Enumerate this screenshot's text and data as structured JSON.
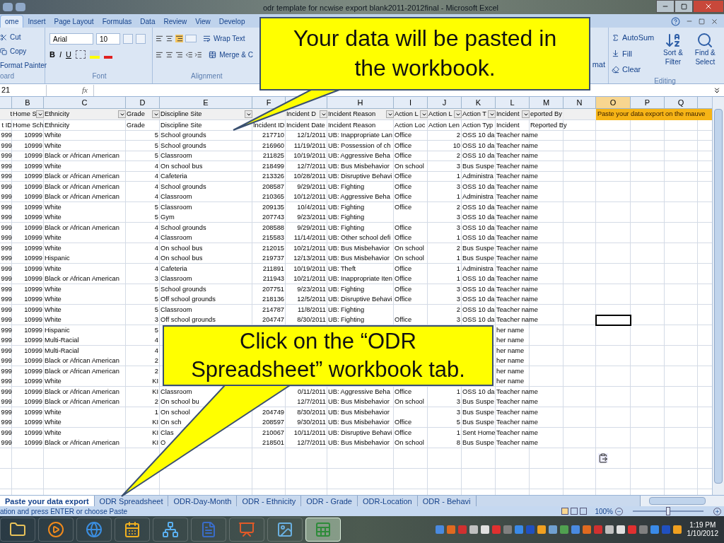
{
  "window": {
    "title": "odr template for ncwise export blank2011-2012final - Microsoft Excel"
  },
  "ribbon": {
    "tabs": [
      {
        "label": "ome",
        "selected": true
      },
      {
        "label": "Insert",
        "selected": false
      },
      {
        "label": "Page Layout",
        "selected": false
      },
      {
        "label": "Formulas",
        "selected": false
      },
      {
        "label": "Data",
        "selected": false
      },
      {
        "label": "Review",
        "selected": false
      },
      {
        "label": "View",
        "selected": false
      },
      {
        "label": "Develop",
        "selected": false
      }
    ],
    "clipboard": {
      "cut": "Cut",
      "copy": "Copy",
      "format_painter": "Format Painter",
      "label": "oard"
    },
    "font": {
      "name": "Arial",
      "size": "10",
      "bold": "B",
      "italic": "I",
      "underline": "U",
      "label": "Font"
    },
    "alignment": {
      "wrap": "Wrap Text",
      "merge": "Merge & C",
      "label": "Alignment"
    },
    "cells_fragment": "mat",
    "editing": {
      "autosum": "AutoSum",
      "fill": "Fill",
      "clear": "Clear",
      "sort": "Sort & Filter",
      "find": "Find & Select",
      "label": "Editing"
    }
  },
  "formula_bar": {
    "name_box": "21",
    "fx": "fx"
  },
  "columns": [
    {
      "letter": "B",
      "selected": false
    },
    {
      "letter": "C",
      "selected": false
    },
    {
      "letter": "D",
      "selected": false
    },
    {
      "letter": "E",
      "selected": false
    },
    {
      "letter": "F",
      "selected": false
    },
    {
      "selected": false
    },
    {
      "letter": "H",
      "selected": false
    },
    {
      "letter": "I",
      "selected": false
    },
    {
      "letter": "J",
      "selected": false
    },
    {
      "letter": "K",
      "selected": false
    },
    {
      "letter": "L",
      "selected": false
    },
    {
      "letter": "M",
      "selected": false
    },
    {
      "letter": "N",
      "selected": false
    },
    {
      "letter": "O",
      "selected": true
    },
    {
      "letter": "P",
      "selected": false
    },
    {
      "letter": "Q",
      "selected": false
    }
  ],
  "filter_row": {
    "A": "t",
    "B": "Home S",
    "C": "Ethnicity",
    "D": "Grade",
    "E": "Discipline Site",
    "G": "Incident D",
    "H": "Incident Reason",
    "I": "Action L",
    "J": "Action L",
    "K": "Action T",
    "L": "Incident",
    "M": "eported By"
  },
  "banner": "Paste your data export on the mauve",
  "field_row": {
    "A": "t ID",
    "B": "Home Sch",
    "C": "Ethnicity",
    "D": "Grade",
    "E": "Discipline Site",
    "F": "Incident ID",
    "G": "Incident Date",
    "H": "Incident Reason",
    "I": "Action Loc",
    "J": "Action Len",
    "K": "Action Typ",
    "L": "Incident",
    "M": "Reported By"
  },
  "rows": [
    {
      "active_cell": false,
      "cells": {
        "A": "999",
        "B": "10999",
        "C": "White",
        "D": "5",
        "E": "School grounds",
        "F": "217710",
        "G": "12/1/2011",
        "H": "UB: Inappropriate Lan",
        "I": "Office",
        "J": "2",
        "K": "OSS 10 da",
        "L": "Teacher name"
      }
    },
    {
      "active_cell": false,
      "cells": {
        "A": "999",
        "B": "10999",
        "C": "White",
        "D": "5",
        "E": "School grounds",
        "F": "216960",
        "G": "11/19/2011",
        "H": "UB: Possession of ch",
        "I": "Office",
        "J": "10",
        "K": "OSS 10 da",
        "L": "Teacher name"
      }
    },
    {
      "active_cell": false,
      "cells": {
        "A": "999",
        "B": "10999",
        "C": "Black or African American",
        "D": "5",
        "E": "Classroom",
        "F": "211825",
        "G": "10/19/2011",
        "H": "UB: Aggressive Beha",
        "I": "Office",
        "J": "2",
        "K": "OSS 10 da",
        "L": "Teacher name"
      }
    },
    {
      "active_cell": false,
      "cells": {
        "A": "999",
        "B": "10999",
        "C": "White",
        "D": "4",
        "E": "On school bus",
        "F": "218499",
        "G": "12/7/2011",
        "H": "UB: Bus Misbehavior",
        "I": "On school",
        "J": "3",
        "K": "Bus Suspe",
        "L": "Teacher name"
      }
    },
    {
      "active_cell": false,
      "cells": {
        "A": "999",
        "B": "10999",
        "C": "Black or African American",
        "D": "4",
        "E": "Cafeteria",
        "F": "213326",
        "G": "10/28/2011",
        "H": "UB: Disruptive Behavi",
        "I": "Office",
        "J": "1",
        "K": "Administra",
        "L": "Teacher name"
      }
    },
    {
      "active_cell": false,
      "cells": {
        "A": "999",
        "B": "10999",
        "C": "Black or African American",
        "D": "4",
        "E": "School grounds",
        "F": "208587",
        "G": "9/29/2011",
        "H": "UB: Fighting",
        "I": "Office",
        "J": "3",
        "K": "OSS 10 da",
        "L": "Teacher name"
      }
    },
    {
      "active_cell": false,
      "cells": {
        "A": "999",
        "B": "10999",
        "C": "Black or African American",
        "D": "4",
        "E": "Classroom",
        "F": "210365",
        "G": "10/12/2011",
        "H": "UB: Aggressive Beha",
        "I": "Office",
        "J": "1",
        "K": "Administra",
        "L": "Teacher name"
      }
    },
    {
      "active_cell": false,
      "cells": {
        "A": "999",
        "B": "10999",
        "C": "White",
        "D": "5",
        "E": "Classroom",
        "F": "209135",
        "G": "10/4/2011",
        "H": "UB: Fighting",
        "I": "Office",
        "J": "2",
        "K": "OSS 10 da",
        "L": "Teacher name"
      }
    },
    {
      "active_cell": false,
      "cells": {
        "A": "999",
        "B": "10999",
        "C": "White",
        "D": "5",
        "E": "Gym",
        "F": "207743",
        "G": "9/23/2011",
        "H": "UB: Fighting",
        "J": "3",
        "K": "OSS 10 da",
        "L": "Teacher name"
      }
    },
    {
      "active_cell": false,
      "cells": {
        "A": "999",
        "B": "10999",
        "C": "Black or African American",
        "D": "4",
        "E": "School grounds",
        "F": "208588",
        "G": "9/29/2011",
        "H": "UB: Fighting",
        "I": "Office",
        "J": "3",
        "K": "OSS 10 da",
        "L": "Teacher name"
      }
    },
    {
      "active_cell": false,
      "cells": {
        "A": "999",
        "B": "10999",
        "C": "White",
        "D": "4",
        "E": "Classroom",
        "F": "215583",
        "G": "11/14/2011",
        "H": "UB: Other school defi",
        "I": "Office",
        "J": "1",
        "K": "OSS 10 da",
        "L": "Teacher name"
      }
    },
    {
      "active_cell": false,
      "cells": {
        "A": "999",
        "B": "10999",
        "C": "White",
        "D": "4",
        "E": "On school bus",
        "F": "212015",
        "G": "10/21/2011",
        "H": "UB: Bus Misbehavior",
        "I": "On school",
        "J": "2",
        "K": "Bus Suspe",
        "L": "Teacher name"
      }
    },
    {
      "active_cell": false,
      "cells": {
        "A": "999",
        "B": "10999",
        "C": "Hispanic",
        "D": "4",
        "E": "On school bus",
        "F": "219737",
        "G": "12/13/2011",
        "H": "UB: Bus Misbehavior",
        "I": "On school",
        "J": "1",
        "K": "Bus Suspe",
        "L": "Teacher name"
      }
    },
    {
      "active_cell": false,
      "cells": {
        "A": "999",
        "B": "10999",
        "C": "White",
        "D": "4",
        "E": "Cafeteria",
        "F": "211891",
        "G": "10/19/2011",
        "H": "UB: Theft",
        "I": "Office",
        "J": "1",
        "K": "Administra",
        "L": "Teacher name"
      }
    },
    {
      "active_cell": false,
      "cells": {
        "A": "999",
        "B": "10999",
        "C": "Black or African American",
        "D": "3",
        "E": "Classroom",
        "F": "211943",
        "G": "10/21/2011",
        "H": "UB: Inappropriate Iten",
        "I": "Office",
        "J": "1",
        "K": "OSS 10 da",
        "L": "Teacher name"
      }
    },
    {
      "active_cell": false,
      "cells": {
        "A": "999",
        "B": "10999",
        "C": "White",
        "D": "5",
        "E": "School grounds",
        "F": "207751",
        "G": "9/23/2011",
        "H": "UB: Fighting",
        "I": "Office",
        "J": "3",
        "K": "OSS 10 da",
        "L": "Teacher name"
      }
    },
    {
      "active_cell": false,
      "cells": {
        "A": "999",
        "B": "10999",
        "C": "White",
        "D": "5",
        "E": "Off school grounds",
        "F": "218136",
        "G": "12/5/2011",
        "H": "UB: Disruptive Behavi",
        "I": "Office",
        "J": "3",
        "K": "OSS 10 da",
        "L": "Teacher name"
      }
    },
    {
      "active_cell": false,
      "cells": {
        "A": "999",
        "B": "10999",
        "C": "White",
        "D": "5",
        "E": "Classroom",
        "F": "214787",
        "G": "11/8/2011",
        "H": "UB: Fighting",
        "J": "2",
        "K": "OSS 10 da",
        "L": "Teacher name"
      }
    },
    {
      "active_cell": true,
      "cells": {
        "A": "999",
        "B": "10999",
        "C": "White",
        "D": "3",
        "E": "Off school grounds",
        "F": "204747",
        "G": "8/30/2011",
        "H": "UB: Fighting",
        "I": "Office",
        "J": "3",
        "K": "OSS 10 da",
        "L": "Teacher name"
      }
    },
    {
      "active_cell": false,
      "cells": {
        "A": "999",
        "B": "10999",
        "C": "Hispanic",
        "D": "5",
        "L": "her name"
      }
    },
    {
      "active_cell": false,
      "cells": {
        "A": "999",
        "B": "10999",
        "C": "Multi-Racial",
        "D": "4",
        "L": "her name"
      }
    },
    {
      "active_cell": false,
      "cells": {
        "A": "999",
        "B": "10999",
        "C": "Multi-Racial",
        "D": "4",
        "L": "her name"
      }
    },
    {
      "active_cell": false,
      "cells": {
        "A": "999",
        "B": "10999",
        "C": "Black or African American",
        "D": "2",
        "L": "her name"
      }
    },
    {
      "active_cell": false,
      "cells": {
        "A": "999",
        "B": "10999",
        "C": "Black or African American",
        "D": "2",
        "L": "her name"
      }
    },
    {
      "active_cell": false,
      "cells": {
        "A": "999",
        "B": "10999",
        "C": "White",
        "D": "KI",
        "L": "her name"
      }
    },
    {
      "active_cell": false,
      "cells": {
        "A": "999",
        "B": "10999",
        "C": "Black or African American",
        "D": "KI",
        "E": "Classroom",
        "G": "0/11/2011",
        "H": "UB: Aggressive Beha",
        "I": "Office",
        "J": "1",
        "K": "OSS 10 da",
        "L": "Teacher name"
      }
    },
    {
      "active_cell": false,
      "cells": {
        "A": "999",
        "B": "10999",
        "C": "Black or African American",
        "D": "2",
        "E": "On school bu",
        "G": "12/7/2011",
        "H": "UB: Bus Misbehavior",
        "I": "On school",
        "J": "3",
        "K": "Bus Suspe",
        "L": "Teacher name"
      }
    },
    {
      "active_cell": false,
      "cells": {
        "A": "999",
        "B": "10999",
        "C": "White",
        "D": "1",
        "E": "On school",
        "F": "204749",
        "G": "8/30/2011",
        "H": "UB: Bus Misbehavior",
        "J": "3",
        "K": "Bus Suspe",
        "L": "Teacher name"
      }
    },
    {
      "active_cell": false,
      "cells": {
        "A": "999",
        "B": "10999",
        "C": "White",
        "D": "KI",
        "E": "On sch",
        "F": "208597",
        "G": "9/30/2011",
        "H": "UB: Bus Misbehavior",
        "I": "Office",
        "J": "5",
        "K": "Bus Suspe",
        "L": "Teacher name"
      }
    },
    {
      "active_cell": false,
      "cells": {
        "A": "999",
        "B": "10999",
        "C": "White",
        "D": "KI",
        "E": "Clas",
        "F": "210067",
        "G": "10/11/2011",
        "H": "UB: Disruptive Behavi",
        "I": "Office",
        "J": "1",
        "K": "Sent Home",
        "L": "Teacher name"
      }
    },
    {
      "active_cell": false,
      "cells": {
        "A": "999",
        "B": "10999",
        "C": "Black or African American",
        "D": "KI",
        "E": "O",
        "F": "218501",
        "G": "12/7/2011",
        "H": "UB: Bus Misbehavior",
        "I": "On school",
        "J": "8",
        "K": "Bus Suspe",
        "L": "Teacher name"
      }
    }
  ],
  "sheet_tabs": [
    {
      "label": "Paste your data export",
      "selected": true
    },
    {
      "label": "ODR Spreadsheet",
      "selected": false
    },
    {
      "label": "ODR-Day-Month",
      "selected": false
    },
    {
      "label": "ODR - Ethnicity",
      "selected": false
    },
    {
      "label": "ODR - Grade",
      "selected": false
    },
    {
      "label": "ODR-Location",
      "selected": false
    },
    {
      "label": "ODR - Behavi",
      "selected": false
    }
  ],
  "status_bar": {
    "message": "ation and press ENTER or choose Paste",
    "zoom": "100%",
    "zoom_slider": {
      "level": 0.5
    }
  },
  "taskbar": {
    "apps": [
      {
        "kind": "folder",
        "selected": false
      },
      {
        "kind": "media",
        "selected": false
      },
      {
        "kind": "browser",
        "selected": false
      },
      {
        "kind": "calendar",
        "selected": false
      },
      {
        "kind": "network",
        "selected": false
      },
      {
        "kind": "word",
        "selected": false
      },
      {
        "kind": "slides",
        "selected": false
      },
      {
        "kind": "photo",
        "selected": false
      },
      {
        "kind": "sheet",
        "selected": true
      }
    ],
    "time": "1:19 PM",
    "date": "1/10/2012"
  },
  "callouts": [
    {
      "lines": [
        "Your data will be pasted in",
        "the workbook."
      ]
    },
    {
      "lines": [
        "Click on the “ODR",
        "Spreadsheet” workbook tab."
      ]
    }
  ]
}
